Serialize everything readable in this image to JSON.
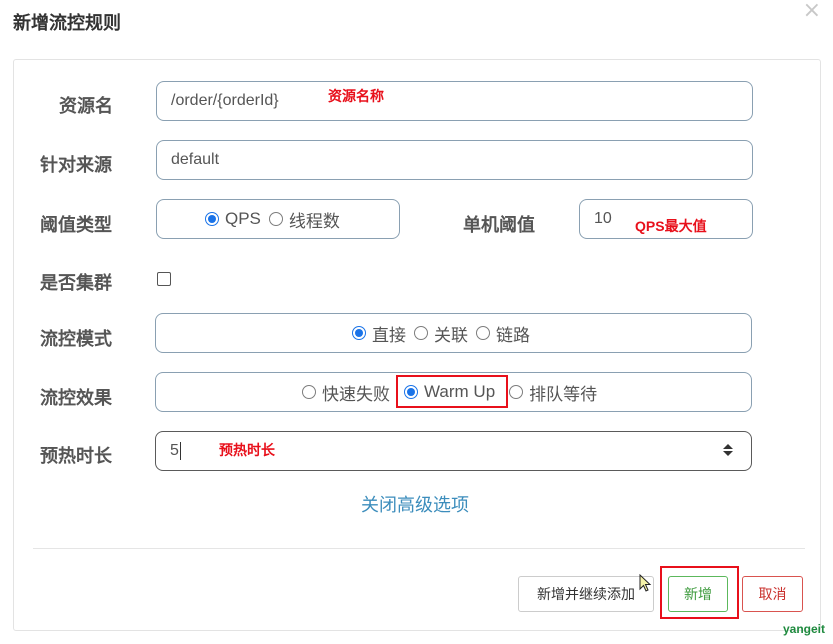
{
  "dialog": {
    "title": "新增流控规则",
    "close_icon": "×"
  },
  "form": {
    "resource_name": {
      "label": "资源名",
      "value": "/order/{orderId}",
      "annotation": "资源名称"
    },
    "source": {
      "label": "针对来源",
      "value": "default"
    },
    "threshold_type": {
      "label": "阈值类型",
      "options": [
        "QPS",
        "线程数"
      ],
      "selected": "QPS"
    },
    "single_threshold": {
      "label": "单机阈值",
      "value": "10",
      "annotation": "QPS最大值"
    },
    "cluster": {
      "label": "是否集群",
      "checked": false
    },
    "flow_mode": {
      "label": "流控模式",
      "options": [
        "直接",
        "关联",
        "链路"
      ],
      "selected": "直接"
    },
    "flow_effect": {
      "label": "流控效果",
      "options": [
        "快速失败",
        "Warm Up",
        "排队等待"
      ],
      "selected": "Warm Up"
    },
    "warmup_period": {
      "label": "预热时长",
      "value": "5",
      "annotation": "预热时长"
    },
    "advanced_toggle": "关闭高级选项"
  },
  "footer": {
    "add_continue": "新增并继续添加",
    "add": "新增",
    "cancel": "取消"
  },
  "watermark": "yangeit",
  "colors": {
    "accent": "#1a73e8",
    "annotation": "#e8101b",
    "link": "#3c8dbc",
    "success": "#5cb85c",
    "danger": "#d9534f"
  }
}
